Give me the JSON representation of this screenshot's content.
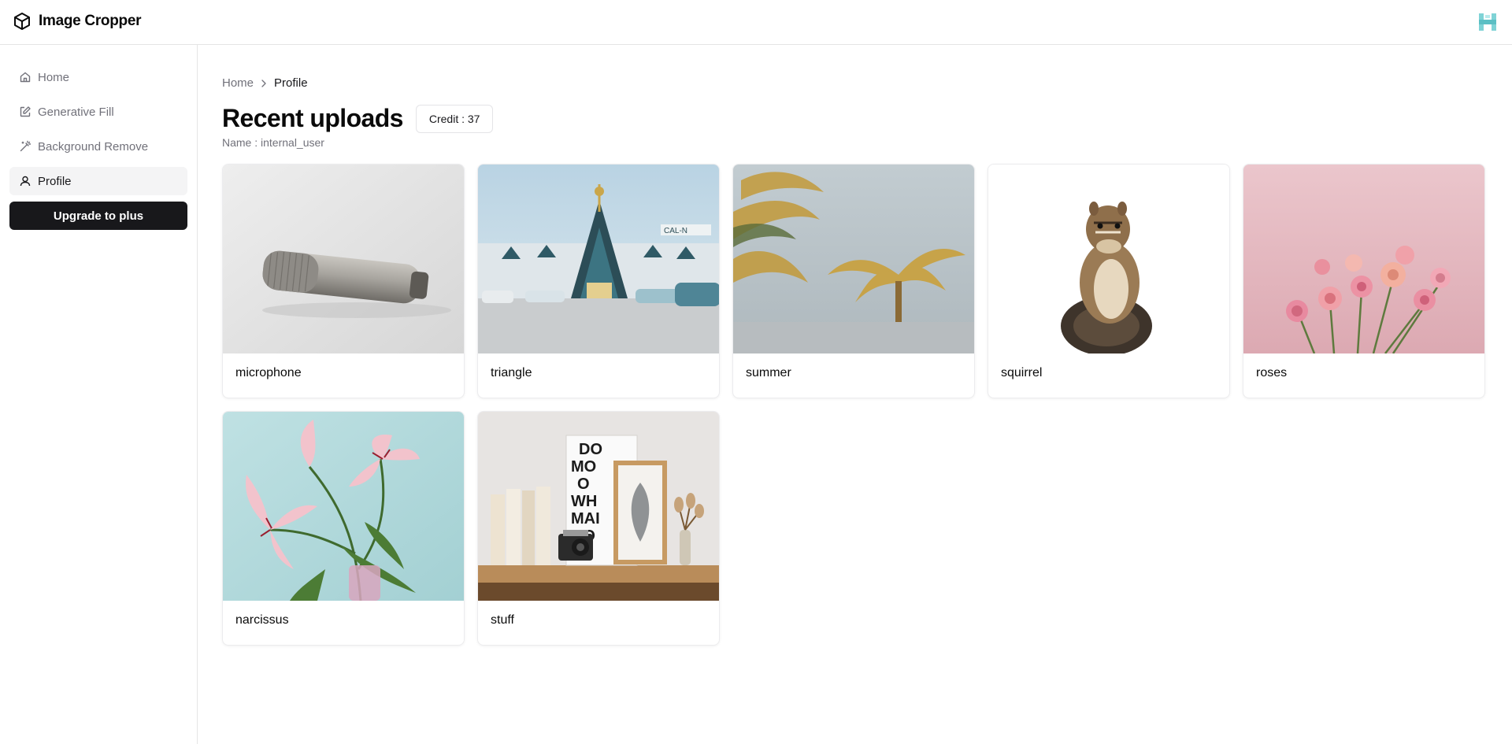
{
  "app": {
    "name": "Image Cropper"
  },
  "sidebar": {
    "items": [
      {
        "label": "Home",
        "icon": "home-icon"
      },
      {
        "label": "Generative Fill",
        "icon": "edit-icon"
      },
      {
        "label": "Background Remove",
        "icon": "wand-icon"
      },
      {
        "label": "Profile",
        "icon": "user-icon",
        "active": true
      }
    ],
    "upgrade_label": "Upgrade to plus"
  },
  "breadcrumb": {
    "home": "Home",
    "current": "Profile"
  },
  "page": {
    "title": "Recent uploads",
    "credit": "Credit : 37",
    "name_line": "Name : internal_user"
  },
  "uploads": [
    {
      "label": "microphone"
    },
    {
      "label": "triangle"
    },
    {
      "label": "summer"
    },
    {
      "label": "squirrel"
    },
    {
      "label": "roses"
    },
    {
      "label": "narcissus"
    },
    {
      "label": "stuff"
    }
  ]
}
